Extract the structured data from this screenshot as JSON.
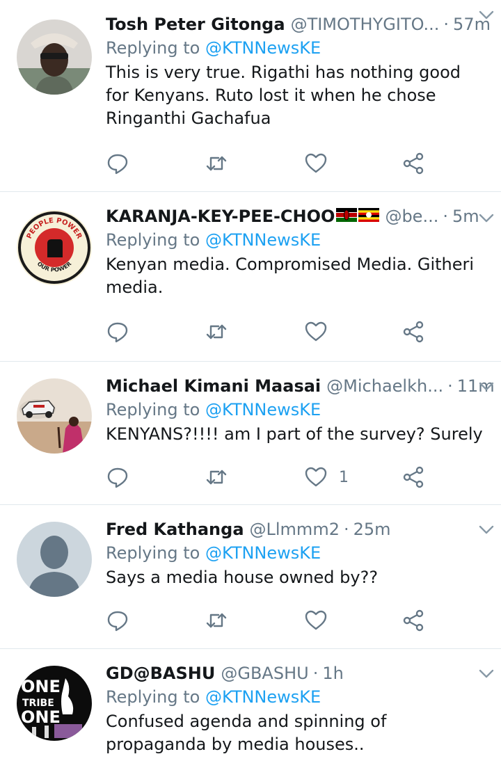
{
  "tweets": [
    {
      "name": "Tosh Peter Gitonga",
      "handle": "@TIMOTHYGITO...",
      "time": "57m",
      "replying_prefix": "Replying to ",
      "replying_handle": "@KTNNewsKE",
      "text": "This is very true. Rigathi has nothing good for Kenyans. Ruto lost it when he chose Ringanthi Gachafua",
      "like_count": ""
    },
    {
      "name": "KARANJA-KEY-PEE-CHOO",
      "handle": "@be...",
      "time": "5m",
      "replying_prefix": "Replying to ",
      "replying_handle": "@KTNNewsKE",
      "text": "Kenyan media. Compromised Media. Githeri media.",
      "like_count": "",
      "avatar_text_top": "PEOPLE POWER",
      "avatar_text_bottom": "OUR POWER"
    },
    {
      "name": "Michael Kimani Maasai",
      "handle": "@Michaelkh...",
      "time": "11m",
      "replying_prefix": "Replying to ",
      "replying_handle": "@KTNNewsKE",
      "text": "KENYANS?!!!! am I part of the survey? Surely",
      "like_count": "1"
    },
    {
      "name": "Fred Kathanga",
      "handle": "@Llmmm2",
      "time": "25m",
      "replying_prefix": "Replying to ",
      "replying_handle": "@KTNNewsKE",
      "text": "Says a media house owned by??",
      "like_count": ""
    },
    {
      "name": "GD@BASHU",
      "handle": "@GBASHU",
      "time": "1h",
      "replying_prefix": "Replying to ",
      "replying_handle": "@KTNNewsKE",
      "text": "Confused agenda and spinning of propaganda by media houses..",
      "like_count": "",
      "avatar_text_1": "ONE",
      "avatar_text_2": "TRIBE",
      "avatar_text_3": "ONE"
    }
  ],
  "colors": {
    "link": "#1da1f2",
    "secondary": "#657786",
    "divider": "#e1e8ed",
    "icon": "#657786"
  },
  "icons": [
    "reply-icon",
    "retweet-icon",
    "like-icon",
    "share-icon",
    "chevron-down-icon"
  ]
}
